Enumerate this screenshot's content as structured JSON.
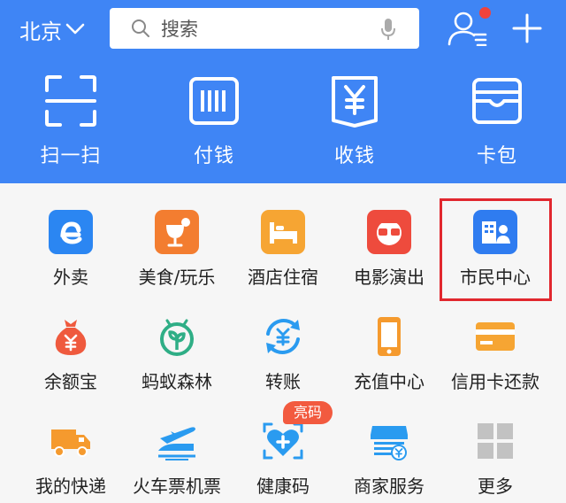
{
  "header": {
    "city": "北京",
    "search_placeholder": "搜索",
    "accent": "#3f85f5"
  },
  "top_actions": [
    {
      "label": "扫一扫",
      "icon": "scan-icon"
    },
    {
      "label": "付钱",
      "icon": "barcode-icon"
    },
    {
      "label": "收钱",
      "icon": "receive-yuan-icon"
    },
    {
      "label": "卡包",
      "icon": "wallet-icon"
    }
  ],
  "grid": [
    {
      "label": "外卖",
      "icon": "eleme-icon"
    },
    {
      "label": "美食/玩乐",
      "icon": "food-icon"
    },
    {
      "label": "酒店住宿",
      "icon": "hotel-bed-icon"
    },
    {
      "label": "电影演出",
      "icon": "movie-glasses-icon"
    },
    {
      "label": "市民中心",
      "icon": "citizen-center-icon"
    },
    {
      "label": "余额宝",
      "icon": "money-bag-icon"
    },
    {
      "label": "蚂蚁森林",
      "icon": "sprout-icon"
    },
    {
      "label": "转账",
      "icon": "transfer-icon"
    },
    {
      "label": "充值中心",
      "icon": "phone-icon"
    },
    {
      "label": "信用卡还款",
      "icon": "credit-card-icon"
    },
    {
      "label": "我的快递",
      "icon": "truck-icon"
    },
    {
      "label": "火车票机票",
      "icon": "train-plane-icon"
    },
    {
      "label": "健康码",
      "icon": "health-code-icon"
    },
    {
      "label": "商家服务",
      "icon": "store-icon"
    },
    {
      "label": "更多",
      "icon": "more-grid-icon"
    }
  ],
  "badge": {
    "health_code": "亮码"
  },
  "highlighted_item": "市民中心"
}
